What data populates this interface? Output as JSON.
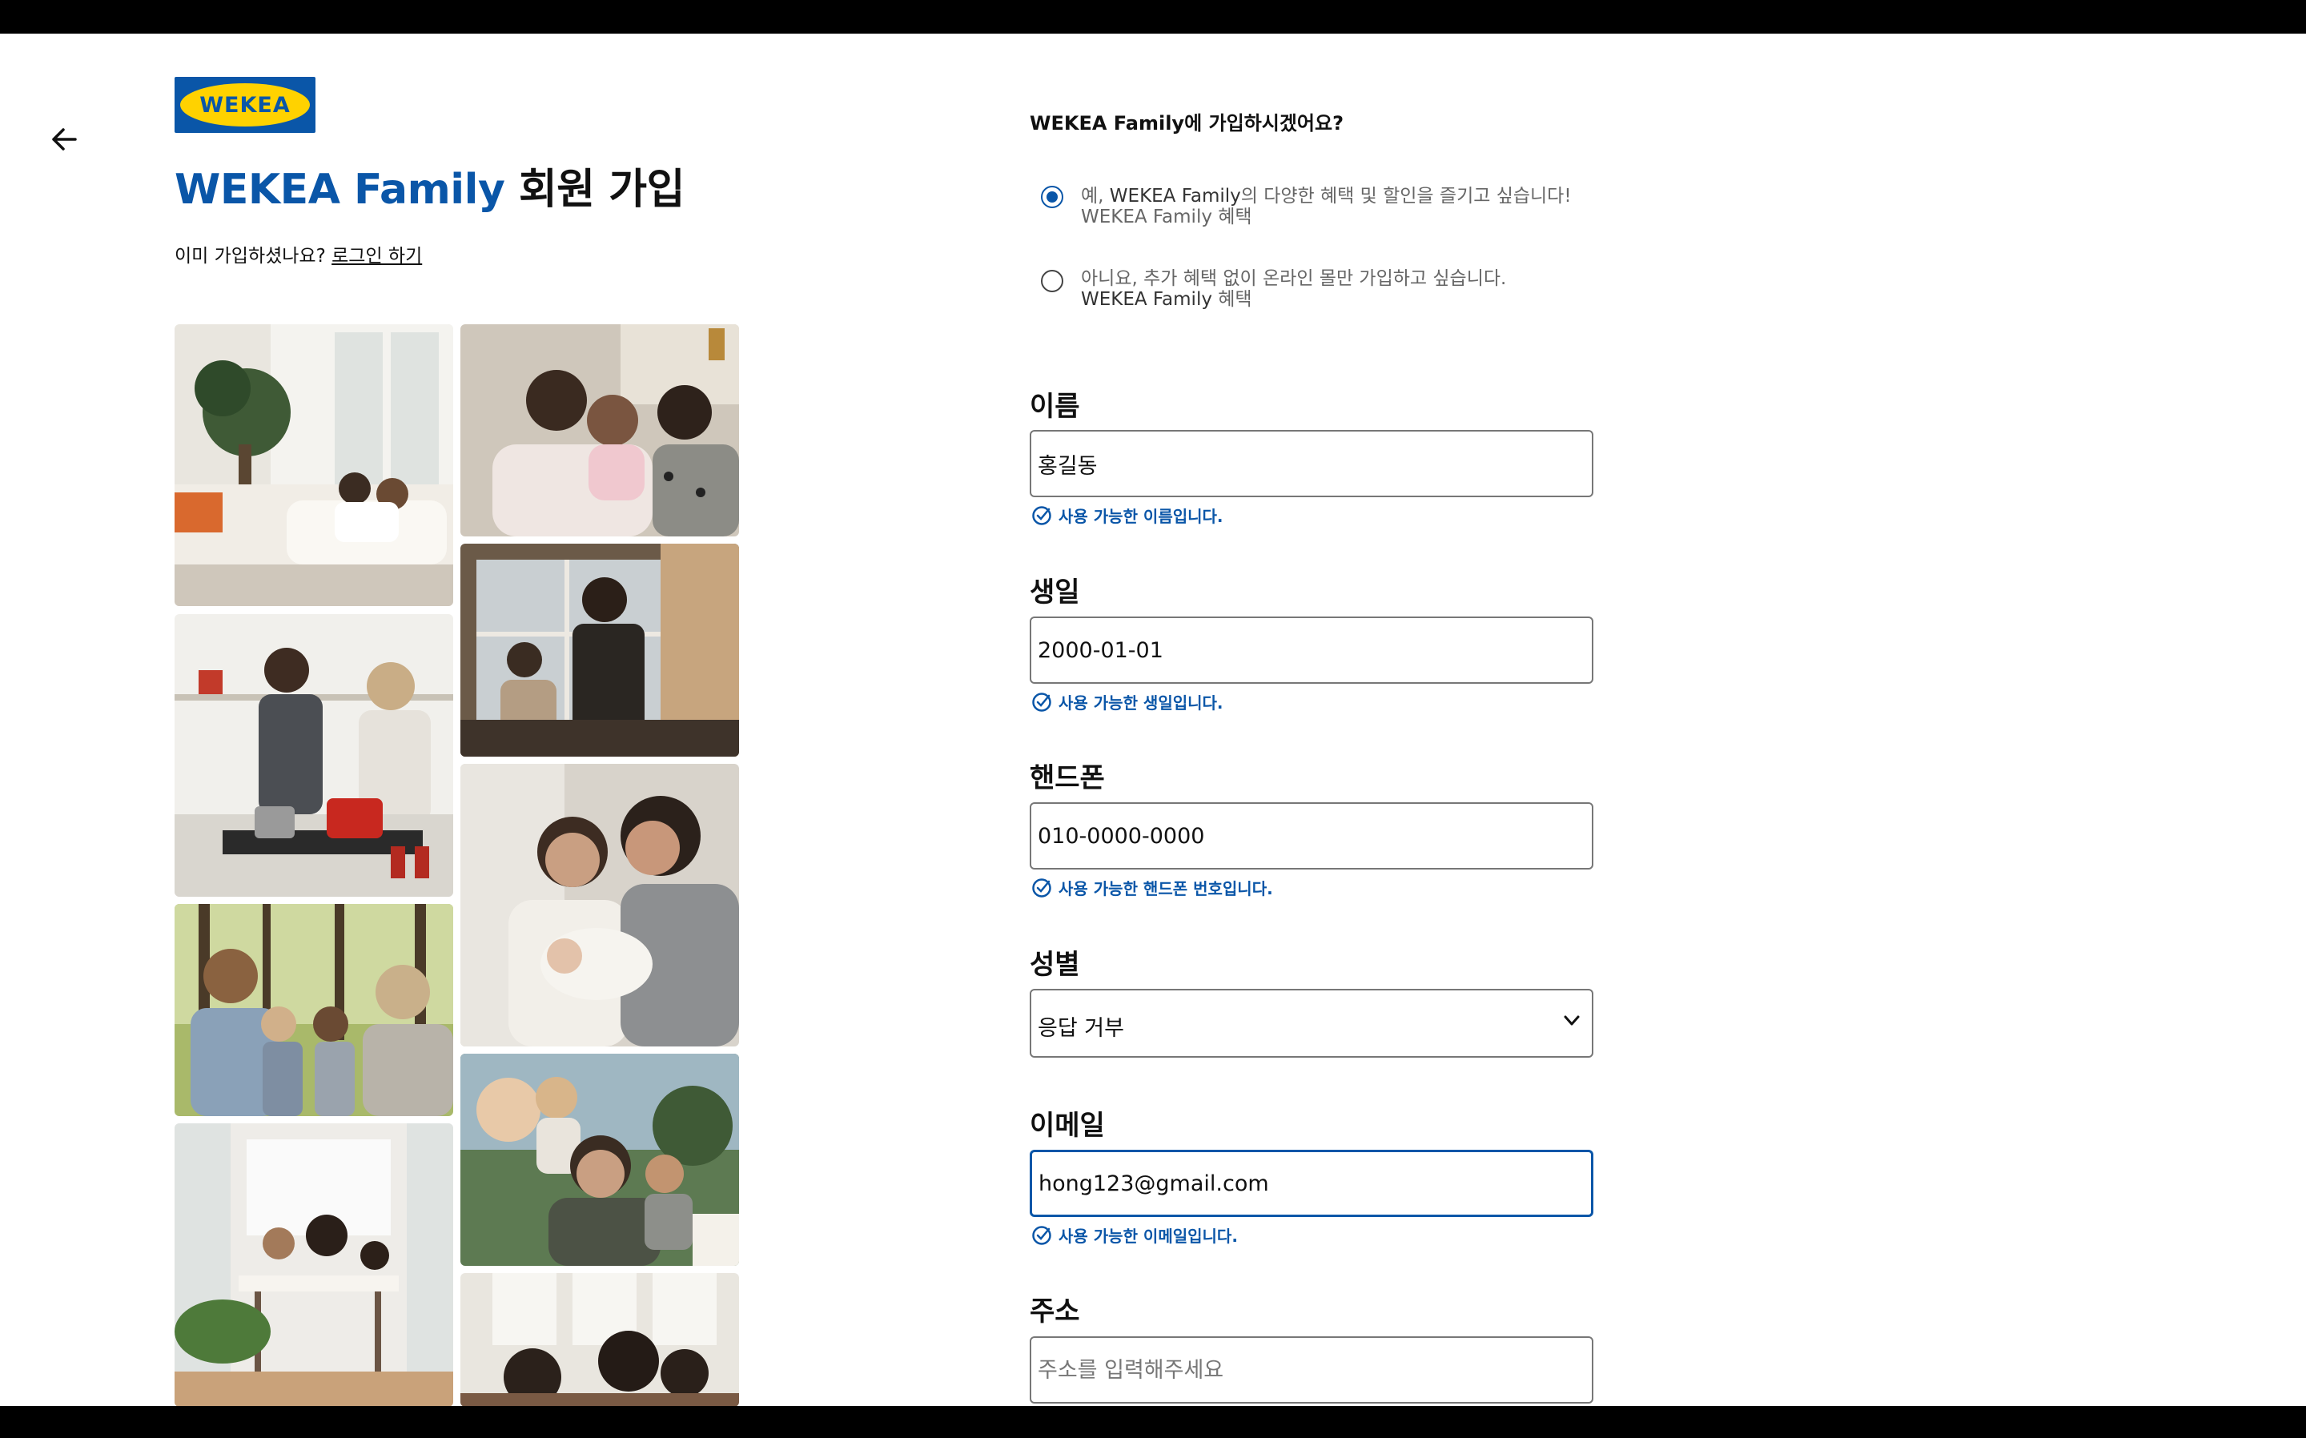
{
  "brand": {
    "logo_text": "WEKEA"
  },
  "header": {
    "title_brand": "WEKEA Family",
    "title_rest": " 회원 가입",
    "already_text": "이미 가입하셨나요? ",
    "login_link": "로그인 하기"
  },
  "join": {
    "question": "WEKEA Family에 가입하시겠어요?",
    "options": [
      {
        "label_prefix": "예, ",
        "label_brand": "WEKEA Family",
        "label_rest": "의 다양한 혜택 및 할인을 즐기고 싶습니다! WEKEA Family 혜택",
        "selected": true
      },
      {
        "label_prefix": "아니요, 추가 혜택 없이 온라인 몰만 가입하고 싶습니다. ",
        "label_brand": "WEKEA Family",
        "label_rest": " 혜택",
        "selected": false
      }
    ]
  },
  "fields": {
    "name": {
      "label": "이름",
      "value": "홍길동",
      "help": "사용 가능한 이름입니다."
    },
    "birthday": {
      "label": "생일",
      "value": "2000-01-01",
      "help": "사용 가능한 생일입니다."
    },
    "phone": {
      "label": "핸드폰",
      "value": "010-0000-0000",
      "help": "사용 가능한 핸드폰 번호입니다."
    },
    "gender": {
      "label": "성별",
      "value": "응답 거부"
    },
    "email": {
      "label": "이메일",
      "value": "hong123@gmail.com",
      "help": "사용 가능한 이메일입니다."
    },
    "address": {
      "label": "주소",
      "value": "",
      "placeholder": "주소를 입력해주세요"
    }
  },
  "colors": {
    "brand_blue": "#0a56a8",
    "brand_yellow": "#ffd200"
  },
  "icons": {
    "back": "arrow-left-icon",
    "valid": "check-circle-icon",
    "dropdown": "chevron-down-icon"
  }
}
